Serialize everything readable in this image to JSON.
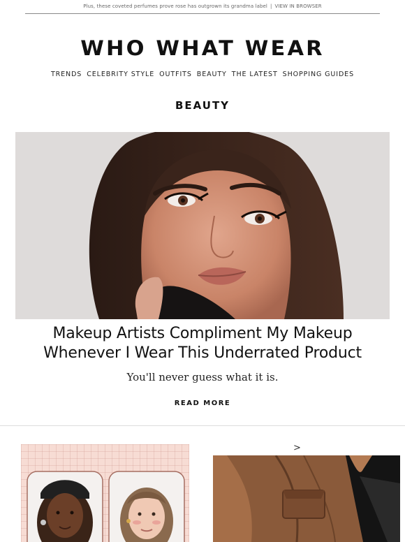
{
  "preheader": {
    "text": "Plus, these coveted perfumes prove rose has outgrown its grandma label",
    "separator": "|",
    "view_in_browser": "VIEW IN BROWSER"
  },
  "brand": {
    "logo": "WHO WHAT WEAR"
  },
  "nav": {
    "items": [
      {
        "label": "TRENDS"
      },
      {
        "label": "CELEBRITY STYLE"
      },
      {
        "label": "OUTFITS"
      },
      {
        "label": "BEAUTY"
      },
      {
        "label": "THE LATEST"
      },
      {
        "label": "SHOPPING GUIDES"
      }
    ]
  },
  "section": {
    "label": "BEAUTY"
  },
  "hero": {
    "title_line1": "Makeup Artists Compliment My Makeup",
    "title_line2": "Whenever I Wear This Underrated Product",
    "subtitle": "You'll never guess what it is.",
    "cta": "READ MORE"
  },
  "secondary": {
    "arrow": ">"
  }
}
